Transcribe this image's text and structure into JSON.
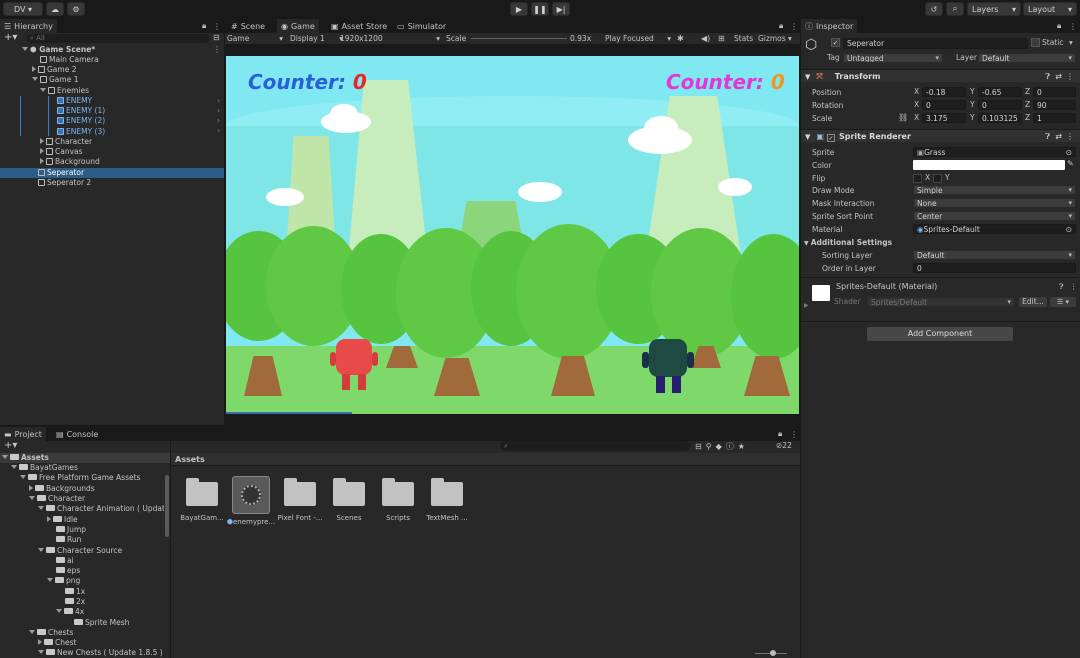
{
  "toolbar": {
    "account": "DV ▾",
    "layers": "Layers",
    "layout": "Layout"
  },
  "hierarchy": {
    "tab": "Hierarchy",
    "search_placeholder": "All",
    "rows": [
      "Game Scene*",
      "Main Camera",
      "Game 2",
      "Game 1",
      "Enemies",
      "ENEMY",
      "ENEMY (1)",
      "ENEMY (2)",
      "ENEMY (3)",
      "Character",
      "Canvas",
      "Background",
      "Seperator",
      "Seperator 2"
    ]
  },
  "center_tabs": {
    "scene": "Scene",
    "game": "Game",
    "asset_store": "Asset Store",
    "simulator": "Simulator"
  },
  "game_toolbar": {
    "game": "Game",
    "display": "Display 1",
    "resolution": "1920x1200",
    "scale_label": "Scale",
    "scale_value": "0.93x",
    "play_focused": "Play Focused",
    "stats": "Stats",
    "gizmos": "Gizmos"
  },
  "game": {
    "counter_left_label": "Counter:",
    "counter_left_value": "0",
    "counter_right_label": "Counter:",
    "counter_right_value": "0"
  },
  "inspector": {
    "tab": "Inspector",
    "object_name": "Seperator",
    "static": "Static",
    "tag_label": "Tag",
    "tag": "Untagged",
    "layer_label": "Layer",
    "layer": "Default",
    "transform": {
      "title": "Transform",
      "position_label": "Position",
      "rotation_label": "Rotation",
      "scale_label": "Scale",
      "position": {
        "x": "-0.18",
        "y": "-0.65",
        "z": "0"
      },
      "rotation": {
        "x": "0",
        "y": "0",
        "z": "90"
      },
      "scale": {
        "x": "3.175",
        "y": "0.103125",
        "z": "1"
      }
    },
    "sprite_renderer": {
      "title": "Sprite Renderer",
      "sprite_label": "Sprite",
      "sprite": "Grass",
      "color_label": "Color",
      "flip_label": "Flip",
      "flip_x": "X",
      "flip_y": "Y",
      "draw_mode_label": "Draw Mode",
      "draw_mode": "Simple",
      "mask_label": "Mask Interaction",
      "mask": "None",
      "sort_point_label": "Sprite Sort Point",
      "sort_point": "Center",
      "material_label": "Material",
      "material": "Sprites-Default",
      "additional": "Additional Settings",
      "sorting_layer_label": "Sorting Layer",
      "sorting_layer": "Default",
      "order_label": "Order in Layer",
      "order": "0"
    },
    "material": {
      "name": "Sprites-Default (Material)",
      "shader_label": "Shader",
      "shader": "Sprites/Default",
      "edit": "Edit..."
    },
    "add_component": "Add Component"
  },
  "project": {
    "tab_project": "Project",
    "tab_console": "Console",
    "assets_header": "Assets",
    "visible_count": "22",
    "tree": [
      "Assets",
      "BayatGames",
      "Free Platform Game Assets",
      "Backgrounds",
      "Character",
      "Character Animation ( Update",
      "Idle",
      "Jump",
      "Run",
      "Character Source",
      "ai",
      "eps",
      "png",
      "1x",
      "2x",
      "4x",
      "Sprite Mesh",
      "Chests",
      "Chest",
      "New Chests ( Update 1.8.5 )"
    ],
    "assets": [
      "BayatGam...",
      "enemypre...",
      "Pixel Font -...",
      "Scenes",
      "Scripts",
      "TextMesh ..."
    ]
  },
  "colors": {
    "accent": "#2c5d87",
    "sky": "#7fe8f0",
    "counter_blue": "#2b5fd9",
    "counter_red": "#e8242a",
    "counter_magenta": "#e636d6",
    "counter_orange": "#f0952a",
    "player_red": "#e84a4a",
    "player_green": "#1f4a44"
  }
}
